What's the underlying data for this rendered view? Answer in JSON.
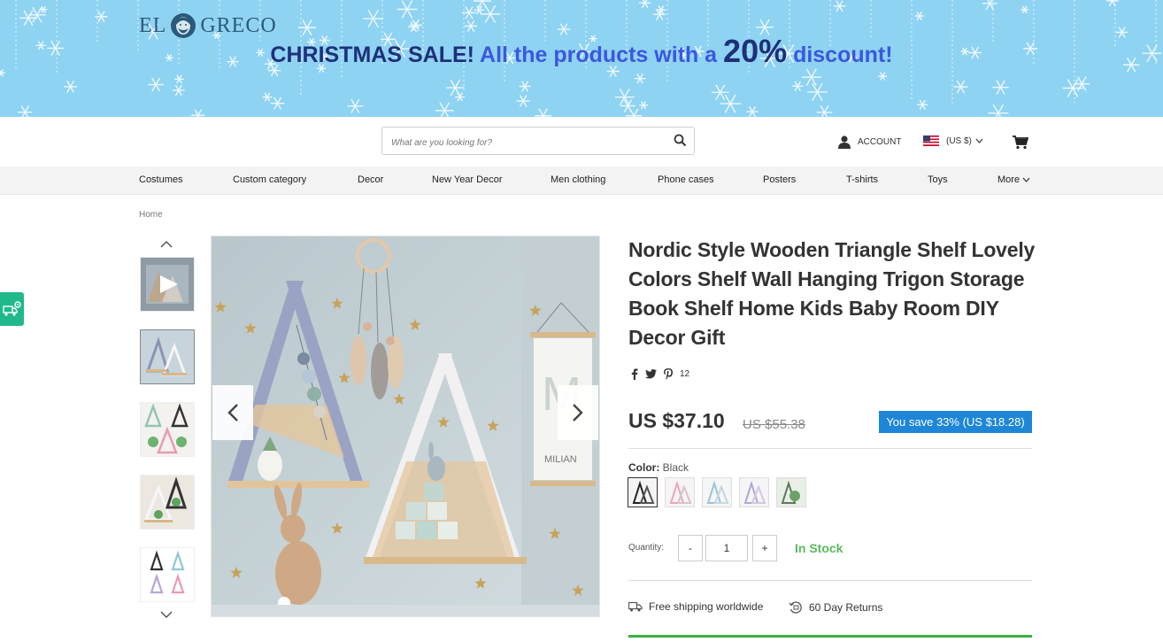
{
  "banner": {
    "part1": "CHRISTMAS SALE!",
    "part2": "All the products with a",
    "part3": "20%",
    "part4": "discount!"
  },
  "logo": {
    "left": "EL",
    "right": "GRECO"
  },
  "search": {
    "placeholder": "What are you looking for?"
  },
  "header": {
    "account_label": "ACCOUNT",
    "currency_label": "(US $)"
  },
  "nav": {
    "items": [
      "Costumes",
      "Custom category",
      "Decor",
      "New Year Decor",
      "Men clothing",
      "Phone cases",
      "Posters",
      "T-shirts",
      "Toys",
      "More"
    ]
  },
  "breadcrumb": {
    "home": "Home"
  },
  "product": {
    "title": "Nordic Style Wooden Triangle Shelf Lovely Colors Shelf Wall Hanging Trigon Storage Book Shelf Home Kids Baby Room DIY Decor Gift",
    "share_count": "12",
    "price": "US $37.10",
    "old_price": "US $55.38",
    "save_text": "You save 33% (US $18.28)",
    "color_label": "Color:",
    "color_value": "Black",
    "quantity_label": "Quantity:",
    "quantity_value": "1",
    "minus": "-",
    "plus": "+",
    "stock": "In Stock",
    "shipping": "Free shipping worldwide",
    "returns": "60 Day Returns",
    "poster_letter": "M",
    "poster_name": "MILIAN"
  },
  "colors": {
    "accent_blue": "#1e86d6",
    "stock_green": "#5cb85c",
    "banner_bg": "#8fd3f2"
  }
}
